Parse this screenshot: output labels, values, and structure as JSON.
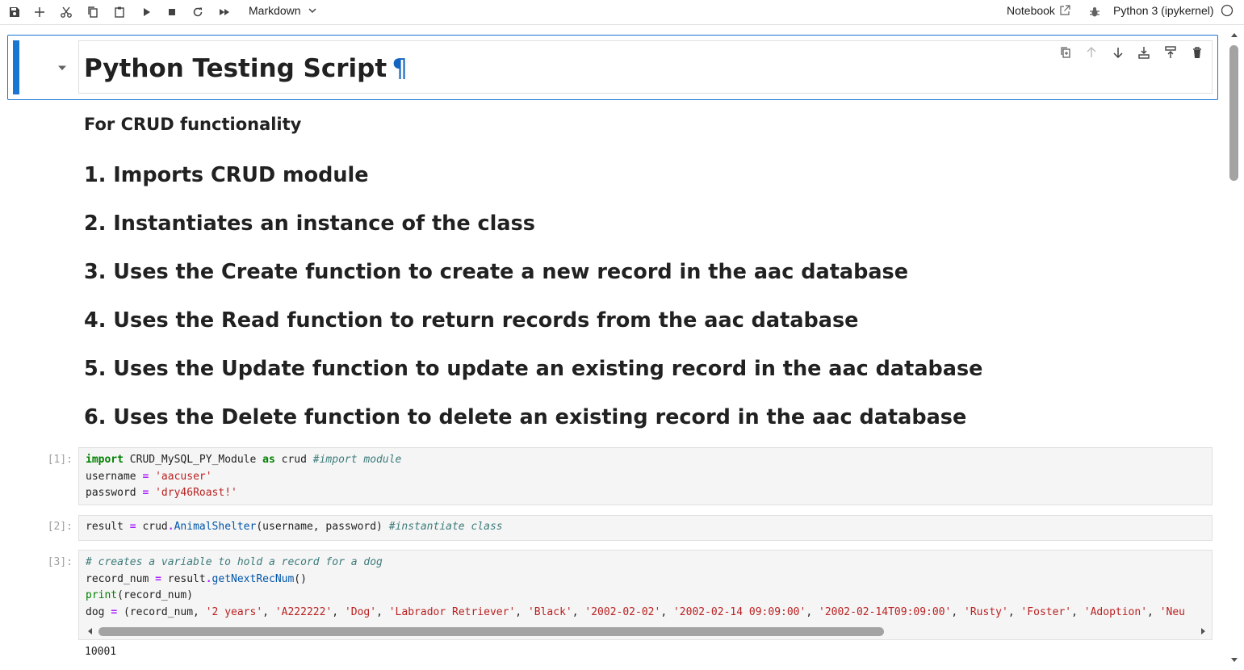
{
  "toolbar": {
    "cell_type": "Markdown",
    "notebook_label": "Notebook",
    "kernel_label": "Python 3 (ipykernel)",
    "buttons": [
      "save-icon",
      "add-icon",
      "cut-icon",
      "copy-icon",
      "paste-icon",
      "run-icon",
      "stop-icon",
      "restart-icon",
      "run-all-icon"
    ]
  },
  "cells": {
    "heading": {
      "title": "Python Testing Script",
      "anchor": "¶"
    },
    "markdown": {
      "subtitle": "For CRUD functionality",
      "items": [
        "1. Imports CRUD module",
        "2. Instantiates an instance of the class",
        "3. Uses the Create function to create a new record in the aac database",
        "4. Uses the Read function to return records from the aac database",
        "5. Uses the Update function to update an existing record in the aac database",
        "6. Uses the Delete function to delete an existing record in the aac database"
      ]
    },
    "code": [
      {
        "prompt": "[1]:",
        "lines": [
          [
            {
              "t": "kw",
              "v": "import"
            },
            {
              "t": "",
              "v": " CRUD_MySQL_PY_Module "
            },
            {
              "t": "kw",
              "v": "as"
            },
            {
              "t": "",
              "v": " crud "
            },
            {
              "t": "cm",
              "v": "#import module"
            }
          ],
          [
            {
              "t": "",
              "v": "username "
            },
            {
              "t": "op",
              "v": "="
            },
            {
              "t": "",
              "v": " "
            },
            {
              "t": "str",
              "v": "'aacuser'"
            }
          ],
          [
            {
              "t": "",
              "v": "password "
            },
            {
              "t": "op",
              "v": "="
            },
            {
              "t": "",
              "v": " "
            },
            {
              "t": "str",
              "v": "'dry46Roast!'"
            }
          ]
        ]
      },
      {
        "prompt": "[2]:",
        "lines": [
          [
            {
              "t": "",
              "v": "result "
            },
            {
              "t": "op",
              "v": "="
            },
            {
              "t": "",
              "v": " crud"
            },
            {
              "t": "op",
              "v": "."
            },
            {
              "t": "fn",
              "v": "AnimalShelter"
            },
            {
              "t": "",
              "v": "(username, password) "
            },
            {
              "t": "cm",
              "v": "#instantiate class"
            }
          ]
        ]
      },
      {
        "prompt": "[3]:",
        "lines": [
          [
            {
              "t": "cm",
              "v": "# creates a variable to hold a record for a dog"
            }
          ],
          [
            {
              "t": "",
              "v": "record_num "
            },
            {
              "t": "op",
              "v": "="
            },
            {
              "t": "",
              "v": " result"
            },
            {
              "t": "op",
              "v": "."
            },
            {
              "t": "fn",
              "v": "getNextRecNum"
            },
            {
              "t": "",
              "v": "()"
            }
          ],
          [
            {
              "t": "bi",
              "v": "print"
            },
            {
              "t": "",
              "v": "(record_num)"
            }
          ],
          [
            {
              "t": "",
              "v": "dog "
            },
            {
              "t": "op",
              "v": "="
            },
            {
              "t": "",
              "v": " (record_num, "
            },
            {
              "t": "str",
              "v": "'2 years'"
            },
            {
              "t": "",
              "v": ", "
            },
            {
              "t": "str",
              "v": "'A222222'"
            },
            {
              "t": "",
              "v": ", "
            },
            {
              "t": "str",
              "v": "'Dog'"
            },
            {
              "t": "",
              "v": ", "
            },
            {
              "t": "str",
              "v": "'Labrador Retriever'"
            },
            {
              "t": "",
              "v": ", "
            },
            {
              "t": "str",
              "v": "'Black'"
            },
            {
              "t": "",
              "v": ", "
            },
            {
              "t": "str",
              "v": "'2002-02-02'"
            },
            {
              "t": "",
              "v": ", "
            },
            {
              "t": "str",
              "v": "'2002-02-14 09:09:00'"
            },
            {
              "t": "",
              "v": ", "
            },
            {
              "t": "str",
              "v": "'2002-02-14T09:09:00'"
            },
            {
              "t": "",
              "v": ", "
            },
            {
              "t": "str",
              "v": "'Rusty'"
            },
            {
              "t": "",
              "v": ", "
            },
            {
              "t": "str",
              "v": "'Foster'"
            },
            {
              "t": "",
              "v": ", "
            },
            {
              "t": "str",
              "v": "'Adoption'"
            },
            {
              "t": "",
              "v": ", "
            },
            {
              "t": "str",
              "v": "'Neu"
            }
          ]
        ],
        "output": "10001"
      }
    ]
  },
  "colors": {
    "accent": "#1976d2",
    "code_bg": "#f5f5f5",
    "keyword": "#008000",
    "string": "#ba2121",
    "comment": "#3d7b7b"
  }
}
